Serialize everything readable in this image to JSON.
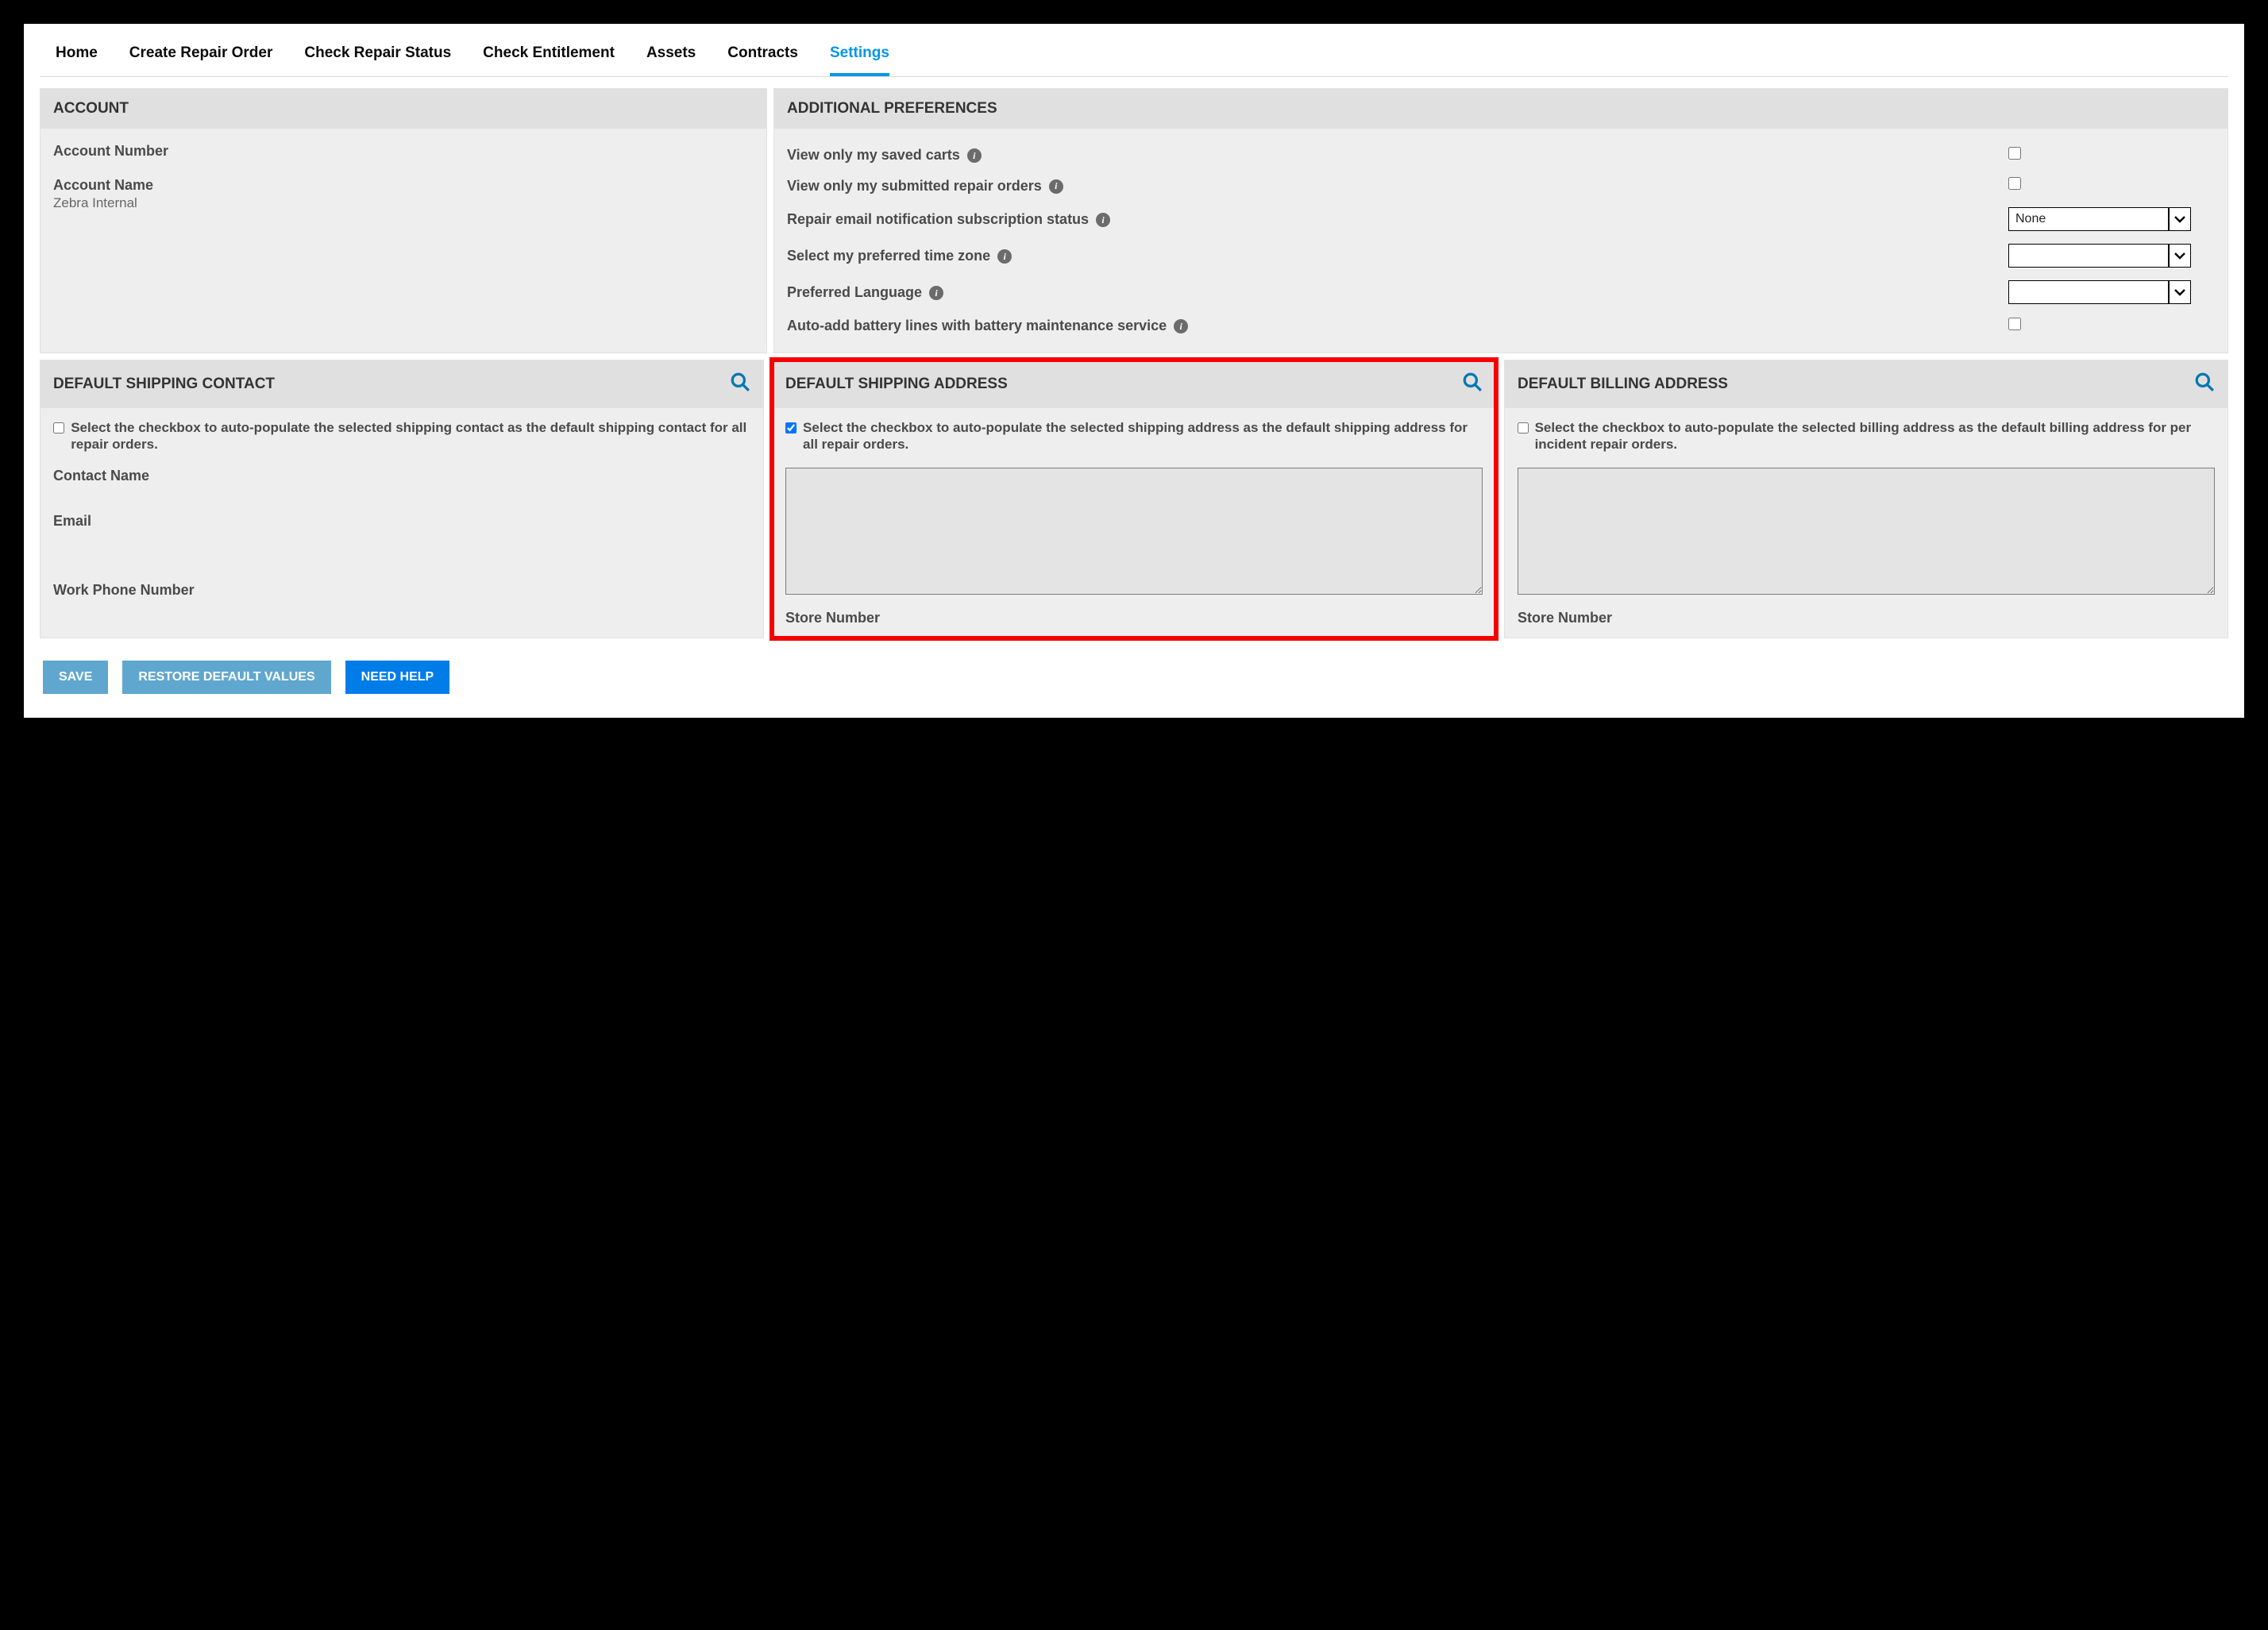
{
  "tabs": {
    "home": "Home",
    "create": "Create Repair Order",
    "status": "Check Repair Status",
    "entitlement": "Check Entitlement",
    "assets": "Assets",
    "contracts": "Contracts",
    "settings": "Settings"
  },
  "account": {
    "title": "ACCOUNT",
    "number_label": "Account Number",
    "number_value": "",
    "name_label": "Account Name",
    "name_value": "Zebra Internal"
  },
  "prefs": {
    "title": "ADDITIONAL PREFERENCES",
    "view_carts": "View only my saved carts",
    "view_orders": "View only my submitted repair orders",
    "email_sub": "Repair email notification subscription status",
    "email_sub_value": "None",
    "timezone": "Select my preferred time zone",
    "timezone_value": "",
    "language": "Preferred Language",
    "language_value": "",
    "battery": "Auto-add battery lines with battery maintenance service"
  },
  "shipping_contact": {
    "title": "DEFAULT SHIPPING CONTACT",
    "checkbox_text": "Select the checkbox to auto-populate the selected shipping contact as the default shipping contact for all repair orders.",
    "contact_name": "Contact Name",
    "email": "Email",
    "phone": "Work Phone Number"
  },
  "shipping_address": {
    "title": "DEFAULT SHIPPING ADDRESS",
    "checkbox_text": "Select the checkbox to auto-populate the selected shipping address as the default shipping address for all repair orders.",
    "store_number": "Store Number"
  },
  "billing_address": {
    "title": "DEFAULT BILLING ADDRESS",
    "checkbox_text": "Select the checkbox to auto-populate the selected billing address as the default billing address for per incident repair orders.",
    "store_number": "Store Number"
  },
  "buttons": {
    "save": "SAVE",
    "restore": "RESTORE DEFAULT VALUES",
    "help": "NEED HELP"
  }
}
